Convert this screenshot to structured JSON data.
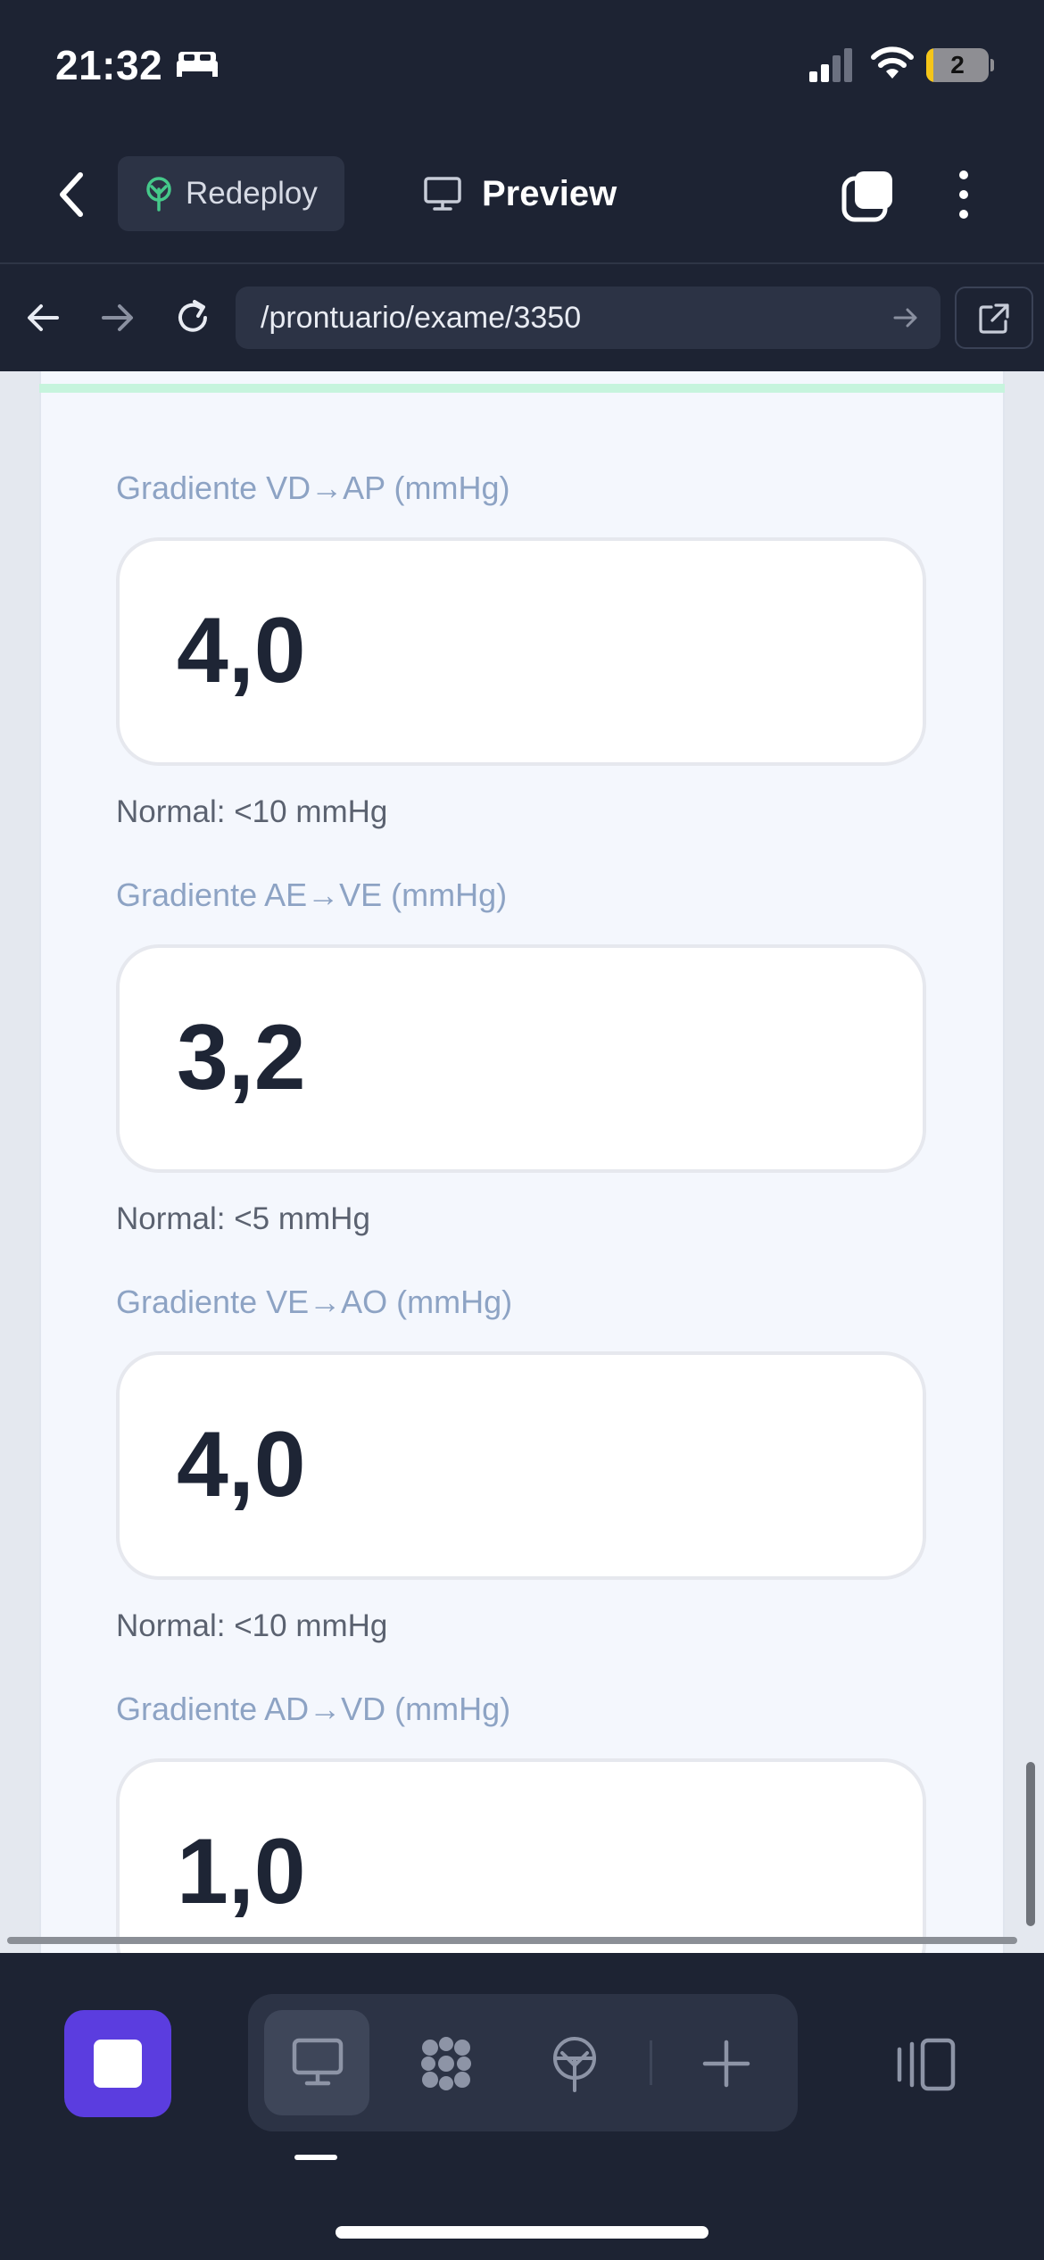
{
  "status_bar": {
    "time": "21:32",
    "battery_level": "2"
  },
  "toolbar": {
    "redeploy_label": "Redeploy",
    "preview_label": "Preview"
  },
  "url_bar": {
    "url": "/prontuario/exame/3350"
  },
  "fields": [
    {
      "label": "Gradiente VD→AP (mmHg)",
      "value": "4,0",
      "normal": "Normal: <10 mmHg"
    },
    {
      "label": "Gradiente AE→VE (mmHg)",
      "value": "3,2",
      "normal": "Normal: <5 mmHg"
    },
    {
      "label": "Gradiente VE→AO (mmHg)",
      "value": "4,0",
      "normal": "Normal: <10 mmHg"
    },
    {
      "label": "Gradiente AD→VD (mmHg)",
      "value": "1,0"
    }
  ],
  "colors": {
    "accent": "#5b3ddf",
    "background": "#1d2333",
    "label": "#8da3c4"
  },
  "icons": {
    "back": "chevron-left-icon",
    "redeploy": "tree-icon",
    "preview": "monitor-icon",
    "tabs": "tabs-icon",
    "more": "more-vertical-icon",
    "reload": "reload-icon",
    "open_external": "external-link-icon",
    "stop": "stop-icon",
    "apps": "apps-icon",
    "deploy": "antenna-icon",
    "add": "plus-icon",
    "side_panel": "side-panel-icon"
  }
}
